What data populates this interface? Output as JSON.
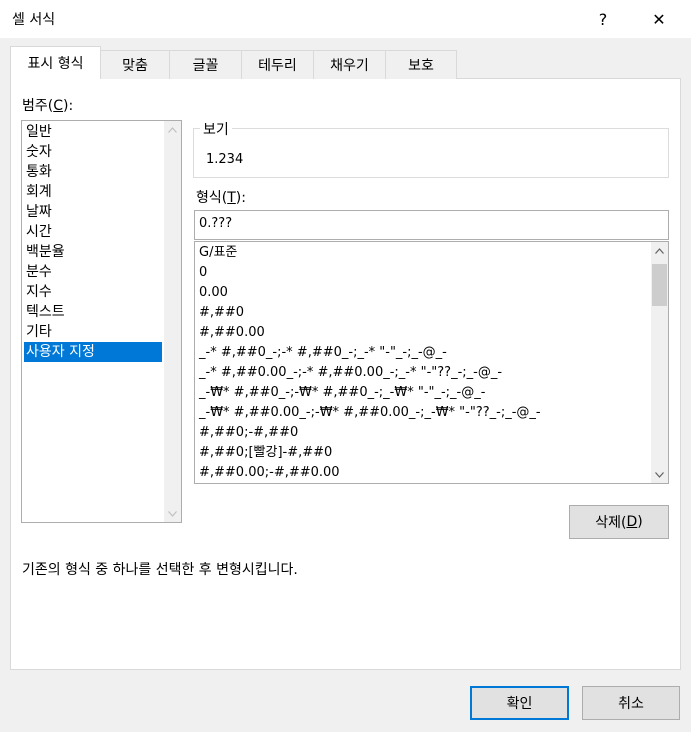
{
  "window": {
    "title": "셀 서식",
    "help_glyph": "?",
    "close_glyph": "✕"
  },
  "tabs": [
    {
      "label": "표시 형식",
      "active": true
    },
    {
      "label": "맞춤",
      "active": false
    },
    {
      "label": "글꼴",
      "active": false
    },
    {
      "label": "테두리",
      "active": false
    },
    {
      "label": "채우기",
      "active": false
    },
    {
      "label": "보호",
      "active": false
    }
  ],
  "category": {
    "label_prefix": "범주(",
    "label_key": "C",
    "label_suffix": "):",
    "items": [
      "일반",
      "숫자",
      "통화",
      "회계",
      "날짜",
      "시간",
      "백분율",
      "분수",
      "지수",
      "텍스트",
      "기타",
      "사용자 지정"
    ],
    "selected": "사용자 지정"
  },
  "sample": {
    "label": "보기",
    "value": "1.234"
  },
  "format": {
    "label_prefix": "형식(",
    "label_key": "T",
    "label_suffix": "):",
    "input_value": "0.???",
    "list": [
      "G/표준",
      "0",
      "0.00",
      "#,##0",
      "#,##0.00",
      "_-* #,##0_-;-* #,##0_-;_-* \"-\"_-;_-@_-",
      "_-* #,##0.00_-;-* #,##0.00_-;_-* \"-\"??_-;_-@_-",
      "_-₩* #,##0_-;-₩* #,##0_-;_-₩* \"-\"_-;_-@_-",
      "_-₩* #,##0.00_-;-₩* #,##0.00_-;_-₩* \"-\"??_-;_-@_-",
      "#,##0;-#,##0",
      "#,##0;[빨강]-#,##0",
      "#,##0.00;-#,##0.00"
    ]
  },
  "delete_button": {
    "label_prefix": "삭제(",
    "label_key": "D",
    "label_suffix": ")"
  },
  "description": "기존의 형식 중 하나를 선택한 후 변형시킵니다.",
  "footer": {
    "ok_label": "확인",
    "cancel_label": "취소"
  },
  "icons": {
    "scroll_up": "up-arrow-icon",
    "scroll_down": "down-arrow-icon"
  }
}
